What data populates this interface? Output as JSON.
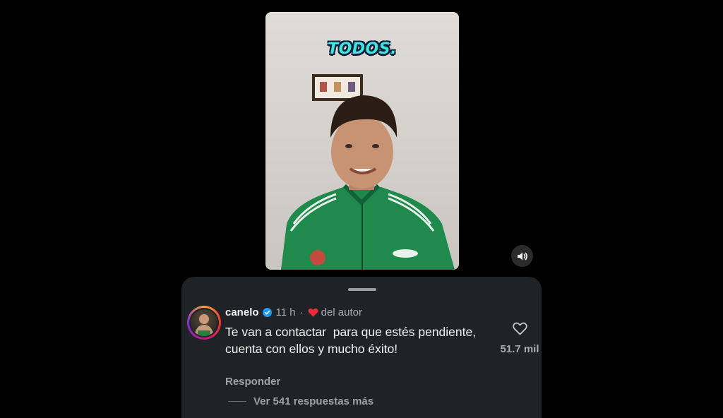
{
  "video": {
    "caption": "TODOS."
  },
  "controls": {
    "sound_icon": "volume-icon"
  },
  "comment": {
    "username": "canelo",
    "verified_icon": "verified-badge-icon",
    "time": "11 h",
    "dot": "·",
    "author_like_icon": "red-heart-icon",
    "author_like_label": "del autor",
    "text": "Te van a contactar  para que estés pendiente, cuenta con ellos y mucho éxito!",
    "reply_label": "Responder",
    "like_count": "51.7 mil",
    "more_replies_label": "Ver 541 respuestas más"
  },
  "colors": {
    "background": "#000000",
    "sheet": "#1f2327",
    "caption": "#3fe6e0",
    "verified": "#1d9bf0",
    "author_heart": "#ed2a37"
  }
}
